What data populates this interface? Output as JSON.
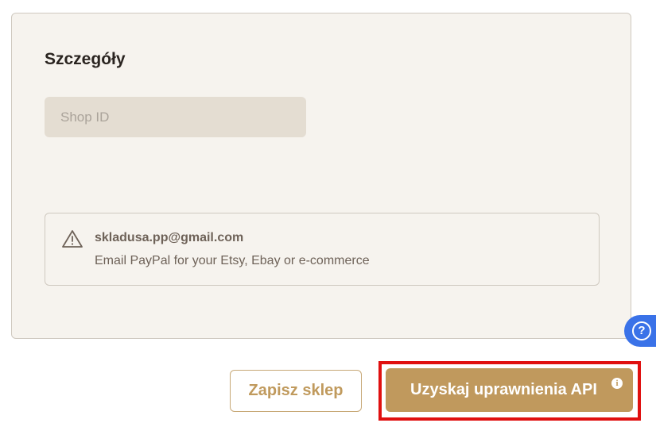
{
  "details": {
    "title": "Szczegóły",
    "shop_id_placeholder": "Shop ID",
    "shop_id_value": ""
  },
  "notice": {
    "icon": "warning-icon",
    "email": "skladusa.pp@gmail.com",
    "description": "Email PayPal for your Etsy, Ebay or e-commerce"
  },
  "help": {
    "icon": "help-icon",
    "glyph": "?"
  },
  "actions": {
    "save_label": "Zapisz sklep",
    "api_label": "Uzyskaj uprawnienia API",
    "info_glyph": "i"
  },
  "colors": {
    "accent": "#c0995d",
    "card_background": "#f6f3ee",
    "highlight": "#e01010",
    "help_bubble": "#3a72e8"
  }
}
